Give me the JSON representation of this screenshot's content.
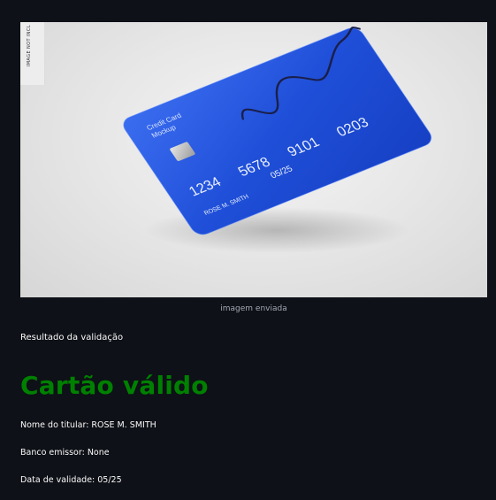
{
  "image": {
    "watermark": "IMAGE NOT INCL",
    "card": {
      "title_line1": "Credit Card",
      "title_line2": "Mockup",
      "number_groups": [
        "1234",
        "5678",
        "9101",
        "0203"
      ],
      "valid_thru": "05/25",
      "holder": "ROSE M. SMITH",
      "color": "#1f4fd8"
    },
    "caption": "imagem enviada"
  },
  "result": {
    "heading": "Resultado da validação",
    "status": "Cartão válido",
    "status_color": "#008000",
    "holder_line": "Nome do titular: ROSE M. SMITH",
    "bank_line": "Banco emissor: None",
    "expiry_line": "Data de validade: 05/25"
  }
}
